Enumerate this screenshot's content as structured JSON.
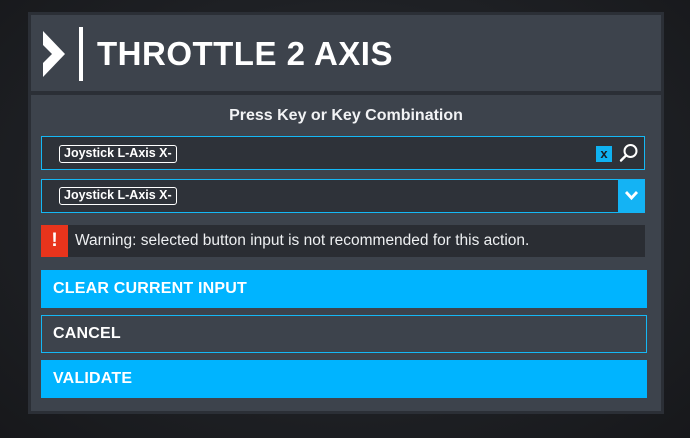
{
  "dialog": {
    "title": "THROTTLE 2 AXIS",
    "prompt": "Press Key or Key Combination",
    "search_field": {
      "value": "Joystick L-Axis X-",
      "clear_label": "x"
    },
    "select_field": {
      "value": "Joystick L-Axis X-"
    },
    "warning": {
      "icon_text": "!",
      "text": "Warning: selected button input is not recommended for this action."
    },
    "buttons": {
      "clear": "CLEAR CURRENT INPUT",
      "cancel": "CANCEL",
      "validate": "VALIDATE"
    }
  },
  "icons": {
    "logo": "chevron-logo-icon",
    "search": "search-icon",
    "dropdown": "chevron-down-icon",
    "warning": "exclamation-icon"
  },
  "colors": {
    "accent": "#00b4ff",
    "warning": "#e8341c",
    "panel": "#3d434c",
    "background": "#2b2f36"
  }
}
